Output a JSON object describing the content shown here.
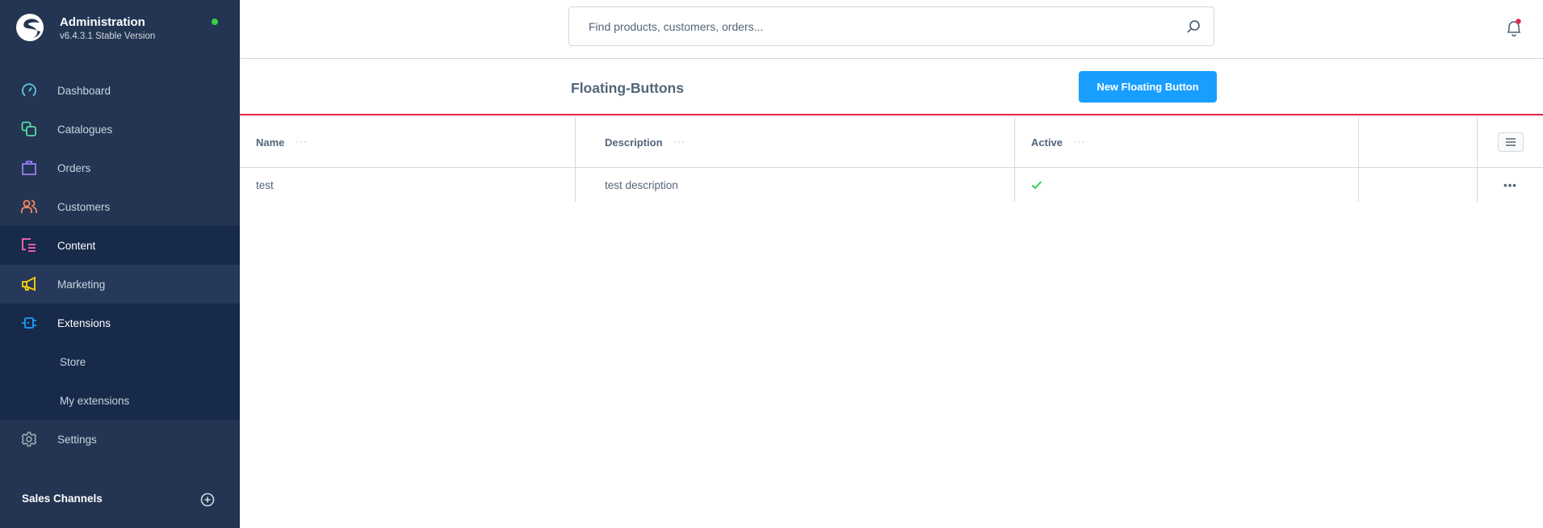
{
  "brand": {
    "title": "Administration",
    "version": "v6.4.3.1 Stable Version",
    "status_color": "#37d046"
  },
  "sidebar": {
    "items": [
      {
        "label": "Dashboard",
        "icon": "dashboard-icon",
        "color": "#5fc8e8"
      },
      {
        "label": "Catalogues",
        "icon": "catalogues-icon",
        "color": "#57d9a3"
      },
      {
        "label": "Orders",
        "icon": "orders-icon",
        "color": "#9a7ff5"
      },
      {
        "label": "Customers",
        "icon": "customers-icon",
        "color": "#f88962"
      },
      {
        "label": "Content",
        "icon": "content-icon",
        "color": "#ff68b4",
        "state": "active"
      },
      {
        "label": "Marketing",
        "icon": "marketing-icon",
        "color": "#ffd700",
        "state": "hover"
      },
      {
        "label": "Extensions",
        "icon": "extensions-icon",
        "color": "#189eff",
        "state": "expanded",
        "children": [
          {
            "label": "Store"
          },
          {
            "label": "My extensions"
          }
        ]
      },
      {
        "label": "Settings",
        "icon": "settings-icon",
        "color": "#9aa8b5"
      }
    ],
    "sales_channels_label": "Sales Channels"
  },
  "search": {
    "placeholder": "Find products, customers, orders...",
    "value": ""
  },
  "notifications": {
    "has_unread": true,
    "dot_color": "#de294c"
  },
  "page": {
    "title": "Floating-Buttons",
    "primary_button": "New Floating Button",
    "accent_color": "#189eff"
  },
  "grid": {
    "columns": [
      {
        "label": "Name",
        "menu": "···"
      },
      {
        "label": "Description",
        "menu": "···"
      },
      {
        "label": "Active",
        "menu": "···"
      }
    ],
    "rows": [
      {
        "name": "test",
        "description": "test description",
        "active": true,
        "actions": "•••"
      }
    ]
  }
}
